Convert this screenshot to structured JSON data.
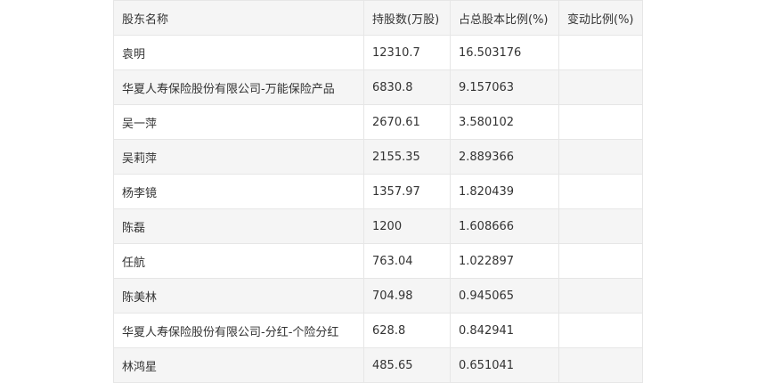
{
  "table": {
    "headers": [
      "股东名称",
      "持股数(万股)",
      "占总股本比例(%)",
      "变动比例(%)"
    ],
    "rows": [
      [
        "袁明",
        "12310.7",
        "16.503176",
        ""
      ],
      [
        "华夏人寿保险股份有限公司-万能保险产品",
        "6830.8",
        "9.157063",
        ""
      ],
      [
        "吴一萍",
        "2670.61",
        "3.580102",
        ""
      ],
      [
        "吴莉萍",
        "2155.35",
        "2.889366",
        ""
      ],
      [
        "杨李镜",
        "1357.97",
        "1.820439",
        ""
      ],
      [
        "陈磊",
        "1200",
        "1.608666",
        ""
      ],
      [
        "任航",
        "763.04",
        "1.022897",
        ""
      ],
      [
        "陈美林",
        "704.98",
        "0.945065",
        ""
      ],
      [
        "华夏人寿保险股份有限公司-分红-个险分红",
        "628.8",
        "0.842941",
        ""
      ],
      [
        "林鸿星",
        "485.65",
        "0.651041",
        ""
      ]
    ]
  }
}
